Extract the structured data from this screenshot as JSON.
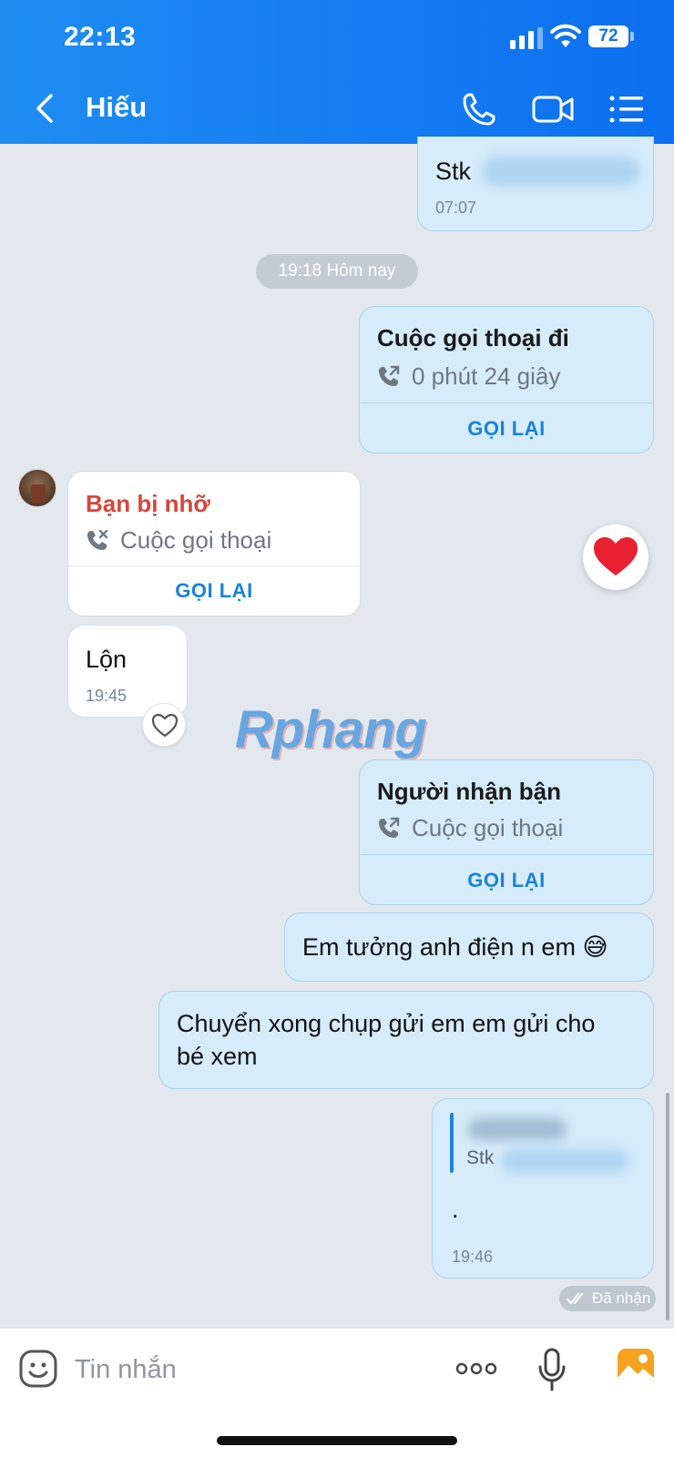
{
  "status_bar": {
    "time": "22:13",
    "battery": "72"
  },
  "header": {
    "title": "Hiếu"
  },
  "messages": {
    "stk_label": "Stk",
    "stk_time": "07:07",
    "date_separator": "19:18 Hôm nay",
    "outgoing_call": {
      "title": "Cuộc gọi thoại đi",
      "detail": "0 phút 24 giây",
      "action": "GỌI LẠI"
    },
    "missed_call": {
      "title": "Bạn bị nhỡ",
      "detail": "Cuộc gọi thoại",
      "action": "GỌI LẠI"
    },
    "lon": {
      "text": "Lộn",
      "time": "19:45"
    },
    "recipient_call": {
      "title": "Người nhận bận",
      "detail": "Cuộc gọi thoại",
      "action": "GỌI LẠI"
    },
    "em_tuong": "Em tưởng anh điện n em 😅",
    "chuyen_line1": "Chuyển xong chụp gửi em em gửi cho",
    "chuyen_line2": "bé xem",
    "reply": {
      "quote_label": "Stk",
      "text": ".",
      "time": "19:46"
    },
    "seen": "Đã nhận"
  },
  "watermark": "Rphang",
  "composer": {
    "placeholder": "Tin nhắn"
  },
  "colors": {
    "header": "#1e8df2",
    "accent": "#1a82d6",
    "missed": "#d8453b",
    "outgoing_bubble": "#d6ecfa",
    "background": "#e3e8ef"
  }
}
